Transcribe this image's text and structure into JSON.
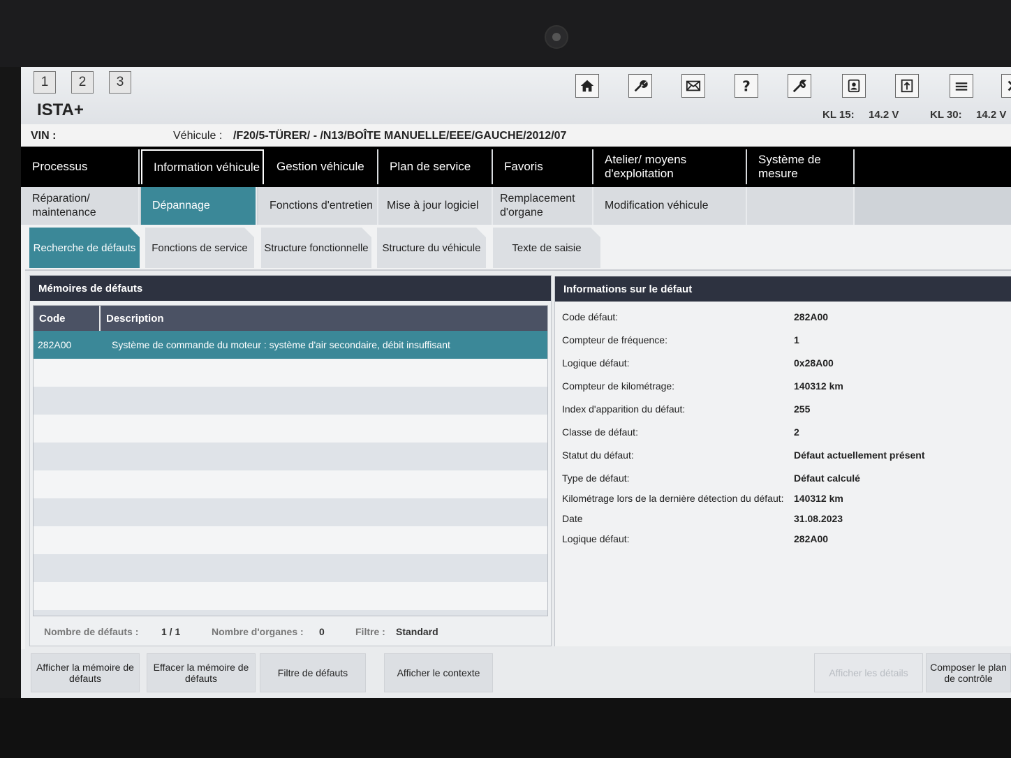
{
  "window_tabs": [
    "1",
    "2",
    "3"
  ],
  "app_title": "ISTA+",
  "toolbar_icons": [
    "home-icon",
    "wrench-icon",
    "mail-icon",
    "help-icon",
    "tools-icon",
    "user-card-icon",
    "transfer-icon",
    "menu-icon",
    "close-icon"
  ],
  "power": {
    "kl15_label": "KL 15:",
    "kl15_value": "14.2 V",
    "kl30_label": "KL 30:",
    "kl30_value": "14.2 V"
  },
  "vin": {
    "vin_label": "VIN :",
    "vehicle_label": "Véhicule :",
    "vehicle_value": "/F20/5-TÜRER/ - /N13/BOÎTE MANUELLE/EEE/GAUCHE/2012/07"
  },
  "main_nav": [
    "Processus",
    "Information véhicule",
    "Gestion véhicule",
    "Plan de service",
    "Favoris",
    "Atelier/ moyens d'exploitation",
    "Système de mesure"
  ],
  "sub_nav": [
    "Réparation/ maintenance",
    "Dépannage",
    "Fonctions d'entretien",
    "Mise à jour logiciel",
    "Remplacement d'organe",
    "Modification véhicule"
  ],
  "tabs": [
    "Recherche de défauts",
    "Fonctions de service",
    "Structure fonctionnelle",
    "Structure du véhicule",
    "Texte de saisie"
  ],
  "fault_memory": {
    "title": "Mémoires de défauts",
    "col_code": "Code",
    "col_description": "Description",
    "rows": [
      {
        "code": "282A00",
        "description": "Système de commande du moteur : système d'air secondaire, débit insuffisant"
      }
    ],
    "status": {
      "count_label": "Nombre de défauts :",
      "count_value": "1 / 1",
      "organs_label": "Nombre d'organes :",
      "organs_value": "0",
      "filter_label": "Filtre :",
      "filter_value": "Standard"
    }
  },
  "fault_info": {
    "title": "Informations sur le défaut",
    "items": [
      {
        "label": "Code défaut:",
        "value": "282A00"
      },
      {
        "label": "Compteur de fréquence:",
        "value": "1"
      },
      {
        "label": "Logique défaut:",
        "value": "0x28A00"
      },
      {
        "label": "Compteur de kilométrage:",
        "value": "140312 km"
      },
      {
        "label": "Index d'apparition du défaut:",
        "value": "255"
      },
      {
        "label": "Classe de défaut:",
        "value": "2"
      },
      {
        "label": "Statut du défaut:",
        "value": "Défaut actuellement présent"
      },
      {
        "label": "Type de défaut:",
        "value": "Défaut calculé"
      },
      {
        "label": "Kilométrage lors de la dernière détection du défaut:",
        "value": "140312 km"
      },
      {
        "label": "Date",
        "value": "31.08.2023"
      },
      {
        "label": "Logique défaut:",
        "value": "282A00"
      }
    ]
  },
  "buttons": {
    "show_memory": "Afficher la mémoire de défauts",
    "clear_memory": "Effacer la mémoire de défauts",
    "filter": "Filtre de défauts",
    "context": "Afficher le contexte",
    "details": "Afficher les détails",
    "plan": "Composer le plan de contrôle"
  }
}
